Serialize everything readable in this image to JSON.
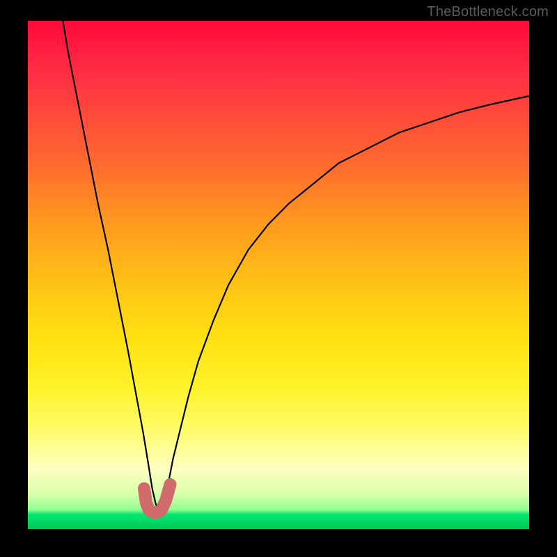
{
  "watermark": "TheBottleneck.com",
  "chart_data": {
    "type": "line",
    "title": "",
    "xlabel": "",
    "ylabel": "",
    "xlim": [
      0,
      100
    ],
    "ylim": [
      0,
      100
    ],
    "grid": false,
    "legend": false,
    "annotations": [],
    "series": [
      {
        "name": "curve",
        "color": "#000000",
        "x": [
          7,
          8,
          10,
          12,
          14,
          16,
          18,
          20,
          21.5,
          23,
          24,
          24.8,
          25.5,
          26,
          26.8,
          28,
          29,
          30.5,
          32,
          34,
          37,
          40,
          44,
          48,
          52,
          57,
          62,
          68,
          74,
          80,
          86,
          92,
          98,
          100
        ],
        "y": [
          100,
          94,
          84,
          74,
          64,
          55,
          45,
          35,
          27,
          19,
          13,
          8,
          5,
          4,
          5,
          9,
          14,
          20,
          26,
          33,
          41,
          48,
          55,
          60,
          64,
          68,
          72,
          75,
          78,
          80,
          82,
          83.5,
          84.8,
          85.2
        ]
      },
      {
        "name": "marker",
        "type": "marker",
        "color": "#d16a6a",
        "x": [
          23.2,
          23.6,
          24.2,
          25.0,
          25.8,
          26.6,
          27.5,
          28.4
        ],
        "y": [
          8.0,
          5.2,
          3.7,
          3.3,
          3.3,
          3.7,
          5.6,
          8.8
        ]
      }
    ]
  }
}
